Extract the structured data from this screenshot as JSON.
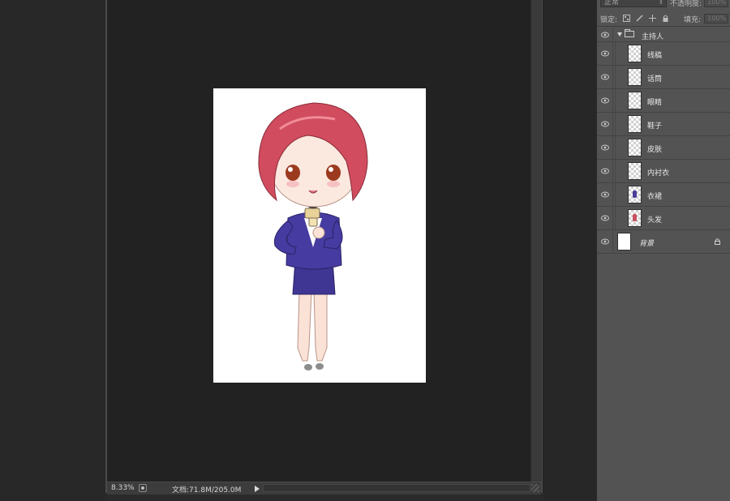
{
  "status_bar": {
    "zoom": "8.33%",
    "doc_size": "文档:71.8M/205.0M"
  },
  "layers_panel": {
    "blend_mode": "正常",
    "opacity_label": "不透明度:",
    "opacity_value": "100%",
    "lock_label": "锁定:",
    "fill_label": "填充:",
    "fill_value": "100%",
    "group": {
      "name": "主持人",
      "expanded": true
    },
    "layers": [
      {
        "name": "线稿",
        "visible": true,
        "thumb": "transparent",
        "mark_color": ""
      },
      {
        "name": "话筒",
        "visible": true,
        "thumb": "transparent",
        "mark_color": ""
      },
      {
        "name": "眼睛",
        "visible": true,
        "thumb": "transparent",
        "mark_color": ""
      },
      {
        "name": "鞋子",
        "visible": true,
        "thumb": "transparent",
        "mark_color": ""
      },
      {
        "name": "皮肤",
        "visible": true,
        "thumb": "transparent",
        "mark_color": ""
      },
      {
        "name": "内衬衣",
        "visible": true,
        "thumb": "transparent",
        "mark_color": ""
      },
      {
        "name": "衣裙",
        "visible": true,
        "thumb": "transparent",
        "mark_color": "#4a3c9a"
      },
      {
        "name": "头发",
        "visible": true,
        "thumb": "transparent",
        "mark_color": "#c9505e"
      }
    ],
    "background_layer": {
      "name": "背景",
      "visible": true,
      "locked": true
    }
  },
  "colors": {
    "app_bg": "#262626",
    "panel_bg": "#535353",
    "hair": "#d04c5e",
    "suit": "#3f3593",
    "skin": "#fbe2d6"
  }
}
